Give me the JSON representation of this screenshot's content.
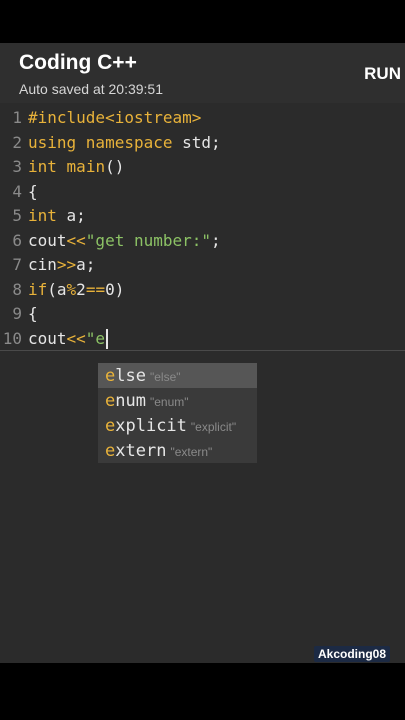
{
  "toolbar": {
    "title": "Coding C++",
    "subtitle": "Auto saved at 20:39:51",
    "run_label": "RUN"
  },
  "editor": {
    "lines": [
      {
        "num": "1",
        "parts": [
          {
            "t": "#include",
            "c": "inc"
          },
          {
            "t": "<iostream>",
            "c": "inc"
          }
        ]
      },
      {
        "num": "2",
        "parts": [
          {
            "t": "using namespace",
            "c": "kw"
          },
          {
            "t": " std;",
            "c": ""
          }
        ]
      },
      {
        "num": "3",
        "parts": [
          {
            "t": "int",
            "c": "kw"
          },
          {
            "t": " ",
            "c": ""
          },
          {
            "t": "main",
            "c": "kw"
          },
          {
            "t": "()",
            "c": ""
          }
        ]
      },
      {
        "num": "4",
        "parts": [
          {
            "t": "{",
            "c": ""
          }
        ]
      },
      {
        "num": "5",
        "parts": [
          {
            "t": "int",
            "c": "kw"
          },
          {
            "t": " a;",
            "c": ""
          }
        ]
      },
      {
        "num": "6",
        "parts": [
          {
            "t": "cout",
            "c": ""
          },
          {
            "t": "<<",
            "c": "op"
          },
          {
            "t": "\"get number:\"",
            "c": "str"
          },
          {
            "t": ";",
            "c": ""
          }
        ]
      },
      {
        "num": "7",
        "parts": [
          {
            "t": "cin",
            "c": ""
          },
          {
            "t": ">>",
            "c": "op"
          },
          {
            "t": "a;",
            "c": ""
          }
        ]
      },
      {
        "num": "8",
        "parts": [
          {
            "t": "if",
            "c": "kw"
          },
          {
            "t": "(a",
            "c": ""
          },
          {
            "t": "%",
            "c": "op"
          },
          {
            "t": "2",
            "c": ""
          },
          {
            "t": "==",
            "c": "op"
          },
          {
            "t": "0)",
            "c": ""
          }
        ]
      },
      {
        "num": "9",
        "parts": [
          {
            "t": "{",
            "c": ""
          }
        ]
      },
      {
        "num": "10",
        "parts": [
          {
            "t": "cout",
            "c": ""
          },
          {
            "t": "<<",
            "c": "op"
          },
          {
            "t": "\"e",
            "c": "str"
          }
        ]
      }
    ]
  },
  "autocomplete": {
    "items": [
      {
        "match": "e",
        "rest": "lse",
        "hint": "\"else\""
      },
      {
        "match": "e",
        "rest": "num",
        "hint": "\"enum\""
      },
      {
        "match": "e",
        "rest": "xplicit",
        "hint": "\"explicit\""
      },
      {
        "match": "e",
        "rest": "xtern",
        "hint": "\"extern\""
      }
    ],
    "selected_index": 0
  },
  "watermark": "Akcoding08",
  "colors": {
    "keyword": "#e8b23a",
    "string": "#8cc265",
    "background": "#2b2b2b"
  }
}
